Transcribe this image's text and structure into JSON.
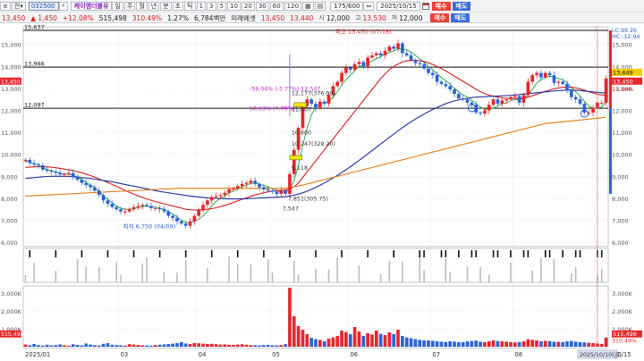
{
  "toolbar": {
    "code": "032500",
    "name": "케이엠더블유",
    "period_buttons": [
      "주",
      "월",
      "년",
      "분",
      "초",
      "틱"
    ],
    "interval_buttons": [
      "1",
      "3",
      "5",
      "10",
      "20",
      "30",
      "60",
      "120"
    ],
    "count": "175/600",
    "date": "2025/10/15",
    "buy_label": "매수",
    "sell_label": "매도",
    "quote": {
      "price": "13,450",
      "change": "▲ 1,450",
      "change_pct": "+12.08%",
      "volume": "515,498",
      "volume_ratio": "310.49%",
      "turnover_pct": "1.27%",
      "amount": "6,784백만",
      "broker": "미래에셋",
      "price2": "13,450",
      "price3": "13,440",
      "open_label": "시",
      "open": "12,000",
      "high_label": "고",
      "high": "13,530",
      "low_label": "저",
      "low": "12,000"
    }
  },
  "price_panel": {
    "tags": {
      "lc": "LC:99.26",
      "hc": "HC:-12.94",
      "last": "13,649",
      "current": "13,450",
      "current_pct": "11.16%"
    },
    "hlines": [
      {
        "value": 15637,
        "label": "15,637"
      },
      {
        "value": 13966,
        "label": "13,966"
      },
      {
        "value": 12097,
        "label": "12,097"
      }
    ],
    "annotations": {
      "high": "최고 15,450 (07/18)",
      "low": "최저 6,750 (04/09)",
      "a1": "-59.04% (-3.77%) 12,547",
      "a2": "50.63% (7.78%)",
      "a3": "12,177(376.90)",
      "a4": "11,807",
      "a5": "10,800",
      "a6": "10,247(329.20)",
      "a7": "9,118",
      "a8": "7,851(305.75)",
      "a9": "7,547"
    }
  },
  "volume_panel": {
    "tags": {
      "value": "515,498",
      "pct": "310.49%"
    }
  },
  "x_axis": {
    "labels": [
      "2025/01",
      "03",
      "04",
      "05",
      "06",
      "07",
      "08",
      "09",
      "10/15"
    ],
    "cursor_label": "2025/10/10(금)"
  },
  "colors": {
    "up": "#e8262b",
    "down": "#2b63d9",
    "ma5": "#1e9e3c",
    "ma20": "#d11f1f",
    "ma60": "#1f2f9e",
    "ma120": "#e07a10",
    "annotation": "#c21fd0"
  },
  "chart_data": {
    "type": "candlestick",
    "ylim": [
      5800,
      15800
    ],
    "yticks": [
      6000,
      7000,
      8000,
      9000,
      10000,
      11000,
      12000,
      13000,
      14000,
      15000
    ],
    "ytick_labels": [
      "6,000",
      "7,000",
      "8,000",
      "9,000",
      "10,000",
      "11,000",
      "12,000",
      "13,000",
      "14,000",
      "15,000"
    ],
    "volume_ylim": [
      0,
      3400
    ],
    "volume_yticks": [
      1000,
      2000,
      3000
    ],
    "volume_ytick_labels": [
      "1,000K",
      "2,000K",
      "3,000K"
    ],
    "volume_unit": "K",
    "x_month_boundaries": [
      "2025/01",
      "03",
      "04",
      "05",
      "06",
      "07",
      "08",
      "09",
      "10/15"
    ],
    "price_series": [
      {
        "name": "close",
        "values": [
          9750,
          9600,
          9550,
          9500,
          9300,
          9250,
          9200,
          9150,
          9080,
          9100,
          9150,
          9000,
          8850,
          8700,
          8600,
          8500,
          8350,
          8150,
          7900,
          7750,
          7600,
          7500,
          7400,
          7400,
          7500,
          7600,
          7650,
          7700,
          7650,
          7550,
          7550,
          7500,
          7400,
          7200,
          7100,
          6950,
          6850,
          6750,
          6950,
          7200,
          7450,
          7700,
          7900,
          8050,
          8100,
          8150,
          8250,
          8400,
          8450,
          8550,
          8650,
          8700,
          8800,
          8650,
          8500,
          8400,
          8350,
          8300,
          8200,
          8350,
          8200,
          9100,
          10200,
          11200,
          12200,
          12500,
          12300,
          12100,
          12400,
          12300,
          12700,
          13100,
          13300,
          13700,
          13950,
          13850,
          14100,
          14200,
          14000,
          14400,
          14500,
          14600,
          14500,
          14700,
          14900,
          14800,
          15050,
          14600,
          14500,
          14300,
          14150,
          14100,
          13900,
          13700,
          13600,
          13300,
          13200,
          13100,
          12950,
          12750,
          12550,
          12500,
          12350,
          12250,
          11900,
          11850,
          12000,
          12250,
          12500,
          12300,
          12450,
          12500,
          12600,
          12650,
          12350,
          12700,
          13300,
          13600,
          13700,
          13500,
          13700,
          13600,
          13250,
          13300,
          13200,
          12900,
          12600,
          12500,
          12300,
          11900,
          11900,
          12100,
          12350,
          12350,
          13450
        ]
      },
      {
        "name": "MA5",
        "values": [
          9700,
          9650,
          9550,
          9500,
          9400,
          9300,
          9250,
          9200,
          9150,
          9100,
          9100,
          9050,
          8950,
          8850,
          8720,
          8600,
          8480,
          8300,
          8100,
          7950,
          7800,
          7650,
          7550,
          7500,
          7500,
          7520,
          7580,
          7620,
          7650,
          7620,
          7600,
          7550,
          7500,
          7400,
          7280,
          7150,
          7000,
          6900,
          6900,
          6950,
          7050,
          7200,
          7400,
          7650,
          7850,
          8000,
          8100,
          8250,
          8320,
          8420,
          8520,
          8600,
          8680,
          8700,
          8650,
          8580,
          8500,
          8440,
          8340,
          8300,
          8260,
          8400,
          8800,
          9500,
          10400,
          11200,
          11800,
          12150,
          12300,
          12320,
          12400,
          12600,
          12850,
          13150,
          13400,
          13600,
          13800,
          14000,
          14050,
          14150,
          14250,
          14350,
          14450,
          14550,
          14650,
          14700,
          14800,
          14780,
          14750,
          14650,
          14500,
          14350,
          14200,
          14000,
          13850,
          13650,
          13500,
          13350,
          13200,
          13000,
          12850,
          12700,
          12600,
          12450,
          12300,
          12150,
          12050,
          12050,
          12100,
          12200,
          12300,
          12350,
          12450,
          12480,
          12500,
          12550,
          12700,
          12950,
          13250,
          13400,
          13500,
          13550,
          13500,
          13450,
          13400,
          13250,
          13050,
          12850,
          12650,
          12400,
          12200,
          12100,
          12100,
          12150,
          12400
        ]
      },
      {
        "name": "MA20",
        "values": [
          9400,
          9420,
          9430,
          9440,
          9440,
          9430,
          9410,
          9390,
          9360,
          9330,
          9300,
          9260,
          9210,
          9160,
          9100,
          9030,
          8960,
          8880,
          8800,
          8720,
          8630,
          8540,
          8450,
          8360,
          8270,
          8190,
          8110,
          8040,
          7970,
          7910,
          7850,
          7800,
          7750,
          7700,
          7650,
          7600,
          7550,
          7500,
          7480,
          7470,
          7470,
          7480,
          7500,
          7530,
          7570,
          7620,
          7680,
          7740,
          7810,
          7880,
          7950,
          8020,
          8090,
          8150,
          8200,
          8250,
          8290,
          8320,
          8340,
          8360,
          8370,
          8420,
          8520,
          8700,
          8950,
          9200,
          9450,
          9700,
          9950,
          10200,
          10450,
          10700,
          10950,
          11200,
          11450,
          11700,
          11950,
          12200,
          12450,
          12700,
          12950,
          13200,
          13450,
          13650,
          13850,
          14000,
          14100,
          14200,
          14250,
          14280,
          14280,
          14260,
          14220,
          14160,
          14090,
          14000,
          13900,
          13790,
          13680,
          13560,
          13440,
          13320,
          13200,
          13080,
          12960,
          12850,
          12760,
          12690,
          12640,
          12600,
          12570,
          12550,
          12540,
          12540,
          12540,
          12560,
          12600,
          12660,
          12730,
          12800,
          12870,
          12930,
          12980,
          13020,
          13050,
          13060,
          13050,
          13020,
          12980,
          12920,
          12850,
          12790,
          12740,
          12700,
          12700
        ]
      },
      {
        "name": "MA60",
        "values": [
          8900,
          8920,
          8940,
          8960,
          8980,
          8990,
          9000,
          9000,
          9000,
          9000,
          8990,
          8980,
          8960,
          8940,
          8920,
          8900,
          8870,
          8840,
          8810,
          8780,
          8750,
          8710,
          8670,
          8630,
          8590,
          8550,
          8510,
          8470,
          8430,
          8390,
          8350,
          8310,
          8280,
          8250,
          8220,
          8190,
          8160,
          8130,
          8100,
          8080,
          8060,
          8040,
          8020,
          8010,
          8000,
          7990,
          7980,
          7970,
          7970,
          7970,
          7970,
          7980,
          7990,
          8000,
          8010,
          8020,
          8030,
          8040,
          8050,
          8060,
          8070,
          8100,
          8140,
          8190,
          8250,
          8320,
          8400,
          8490,
          8590,
          8700,
          8810,
          8920,
          9040,
          9170,
          9300,
          9440,
          9580,
          9720,
          9870,
          10020,
          10170,
          10320,
          10470,
          10620,
          10770,
          10920,
          11070,
          11210,
          11350,
          11480,
          11600,
          11720,
          11830,
          11940,
          12040,
          12130,
          12220,
          12300,
          12370,
          12430,
          12480,
          12520,
          12550,
          12580,
          12600,
          12610,
          12620,
          12630,
          12640,
          12650,
          12660,
          12670,
          12680,
          12700,
          12720,
          12740,
          12760,
          12780,
          12800,
          12820,
          12840,
          12860,
          12880,
          12900,
          12910,
          12920,
          12920,
          12910,
          12900,
          12880,
          12860,
          12840,
          12820,
          12800,
          12800
        ]
      },
      {
        "name": "MA120",
        "values": [
          8100,
          8110,
          8120,
          8130,
          8140,
          8150,
          8160,
          8170,
          8180,
          8190,
          8200,
          8210,
          8220,
          8230,
          8240,
          8250,
          8260,
          8270,
          8280,
          8290,
          8300,
          8310,
          8320,
          8330,
          8340,
          8350,
          8360,
          8370,
          8380,
          8390,
          8400,
          8410,
          8420,
          8430,
          8440,
          8450,
          8450,
          8450,
          8450,
          8450,
          8450,
          8450,
          8450,
          8450,
          8450,
          8450,
          8450,
          8450,
          8450,
          8450,
          8450,
          8450,
          8450,
          8450,
          8450,
          8450,
          8450,
          8450,
          8450,
          8450,
          8450,
          8480,
          8520,
          8560,
          8600,
          8650,
          8700,
          8750,
          8800,
          8850,
          8900,
          8950,
          9000,
          9050,
          9100,
          9150,
          9200,
          9250,
          9300,
          9350,
          9400,
          9450,
          9500,
          9550,
          9600,
          9650,
          9700,
          9750,
          9800,
          9850,
          9900,
          9950,
          10000,
          10050,
          10100,
          10150,
          10200,
          10250,
          10300,
          10350,
          10400,
          10450,
          10500,
          10550,
          10600,
          10650,
          10700,
          10750,
          10800,
          10850,
          10900,
          10950,
          11000,
          11050,
          11100,
          11150,
          11200,
          11250,
          11300,
          11350,
          11400,
          11420,
          11440,
          11460,
          11480,
          11500,
          11520,
          11540,
          11560,
          11580,
          11600,
          11620,
          11640,
          11660,
          11700
        ]
      }
    ],
    "volume_values": [
      120,
      80,
      150,
      90,
      60,
      110,
      70,
      95,
      130,
      85,
      60,
      140,
      100,
      75,
      180,
      120,
      90,
      70,
      160,
      200,
      110,
      90,
      80,
      60,
      140,
      120,
      100,
      80,
      70,
      60,
      90,
      110,
      130,
      150,
      170,
      200,
      260,
      180,
      150,
      210,
      190,
      170,
      150,
      160,
      140,
      120,
      130,
      110,
      100,
      120,
      140,
      110,
      90,
      80,
      70,
      90,
      100,
      80,
      70,
      90,
      140,
      3300,
      1700,
      1150,
      950,
      700,
      500,
      420,
      380,
      300,
      450,
      520,
      600,
      900,
      820,
      700,
      1100,
      850,
      600,
      750,
      680,
      900,
      720,
      650,
      800,
      700,
      950,
      600,
      520,
      480,
      420,
      380,
      360,
      350,
      330,
      300,
      280,
      260,
      300,
      280,
      250,
      260,
      300,
      320,
      340,
      280,
      260,
      300,
      350,
      320,
      300,
      280,
      260,
      240,
      260,
      300,
      420,
      380,
      350,
      300,
      330,
      310,
      280,
      270,
      260,
      300,
      320,
      280,
      260,
      240,
      220,
      200,
      180,
      160,
      515
    ]
  }
}
